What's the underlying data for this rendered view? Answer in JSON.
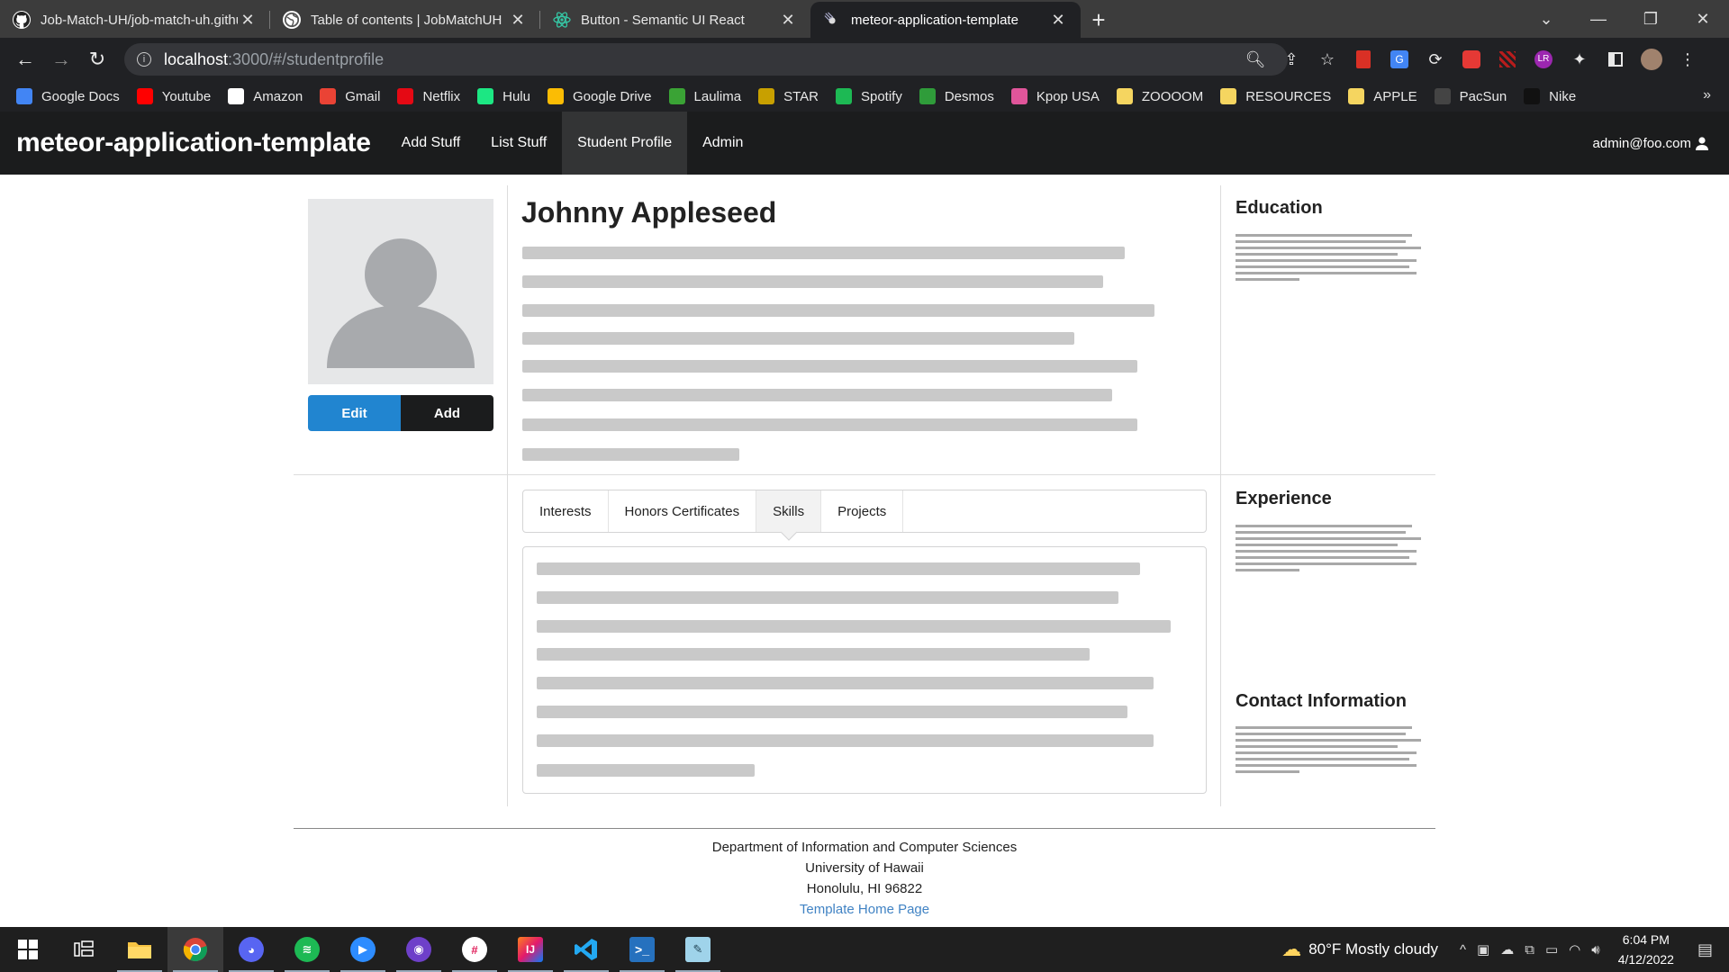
{
  "browser": {
    "tabs": [
      {
        "title": "Job-Match-UH/job-match-uh.github.io",
        "icon": "github-icon"
      },
      {
        "title": "Table of contents | JobMatchUH",
        "icon": "globe-icon"
      },
      {
        "title": "Button - Semantic UI React",
        "icon": "react-icon"
      },
      {
        "title": "meteor-application-template",
        "icon": "meteor-icon"
      }
    ],
    "url_host": "localhost",
    "url_path": ":3000/#/studentprofile",
    "bookmarks": [
      {
        "label": "Google Docs",
        "color": "#4285f4"
      },
      {
        "label": "Youtube",
        "color": "#ff0000"
      },
      {
        "label": "Amazon",
        "color": "#ffffff"
      },
      {
        "label": "Gmail",
        "color": "#ea4335"
      },
      {
        "label": "Netflix",
        "color": "#e50914"
      },
      {
        "label": "Hulu",
        "color": "#1ce783"
      },
      {
        "label": "Google Drive",
        "color": "#fbbc04"
      },
      {
        "label": "Laulima",
        "color": "#3aa335"
      },
      {
        "label": "STAR",
        "color": "#c8a000"
      },
      {
        "label": "Spotify",
        "color": "#1db954"
      },
      {
        "label": "Desmos",
        "color": "#2f9c3a"
      },
      {
        "label": "Kpop USA",
        "color": "#e0559a"
      },
      {
        "label": "ZOOOOM",
        "color": "#f5d560"
      },
      {
        "label": "RESOURCES",
        "color": "#f5d560"
      },
      {
        "label": "APPLE",
        "color": "#f5d560"
      },
      {
        "label": "PacSun",
        "color": "#444444"
      },
      {
        "label": "Nike",
        "color": "#111111"
      }
    ]
  },
  "app": {
    "brand": "meteor-application-template",
    "nav": [
      "Add Stuff",
      "List Stuff",
      "Student Profile",
      "Admin"
    ],
    "active_nav": "Student Profile",
    "user": "admin@foo.com"
  },
  "profile": {
    "name": "Johnny Appleseed",
    "edit_label": "Edit",
    "add_label": "Add",
    "tabs": [
      "Interests",
      "Honors Certificates",
      "Skills",
      "Projects"
    ],
    "active_tab": "Skills"
  },
  "sidebar": {
    "education": "Education",
    "experience": "Experience",
    "contact": "Contact Information"
  },
  "footer": {
    "line1": "Department of Information and Computer Sciences",
    "line2": "University of Hawaii",
    "line3": "Honolulu, HI 96822",
    "link": "Template Home Page"
  },
  "taskbar": {
    "weather": "80°F  Mostly cloudy",
    "time": "6:04 PM",
    "date": "4/12/2022"
  },
  "colors": {
    "primary": "#2185d0",
    "dark": "#1b1c1d",
    "link": "#4183c4"
  }
}
